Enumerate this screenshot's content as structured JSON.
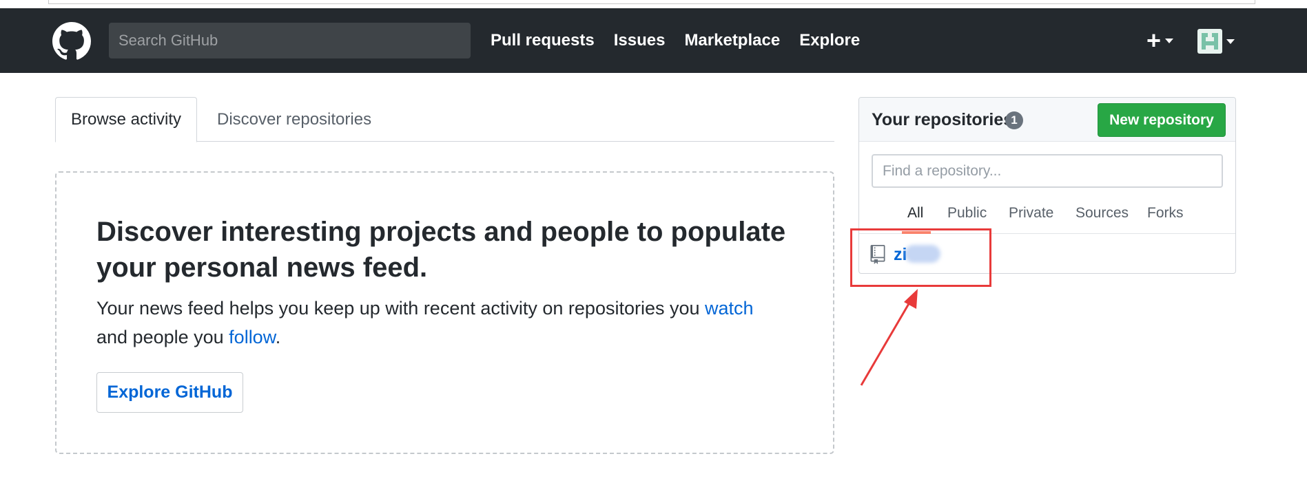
{
  "header": {
    "search_placeholder": "Search GitHub",
    "nav": [
      "Pull requests",
      "Issues",
      "Marketplace",
      "Explore"
    ],
    "plus": "+"
  },
  "tabs": {
    "browse": "Browse activity",
    "discover": "Discover repositories"
  },
  "discover": {
    "title": "Discover interesting projects and people to populate your personal news feed.",
    "text_1": "Your news feed helps you keep up with recent activity on repositories you ",
    "watch_link": "watch",
    "text_2": "and people you ",
    "follow_link": "follow",
    "text_3": ".",
    "button": "Explore GitHub"
  },
  "repos": {
    "title": "Your repositories",
    "count": "1",
    "new_button": "New repository",
    "filter_placeholder": "Find a repository...",
    "filters": [
      "All",
      "Public",
      "Private",
      "Sources",
      "Forks"
    ],
    "items": [
      {
        "name": "zi"
      }
    ]
  },
  "colors": {
    "header_bg": "#24292e",
    "link": "#0366d6",
    "new_repo_green": "#28a745",
    "annotation_red": "#e83a3a"
  }
}
